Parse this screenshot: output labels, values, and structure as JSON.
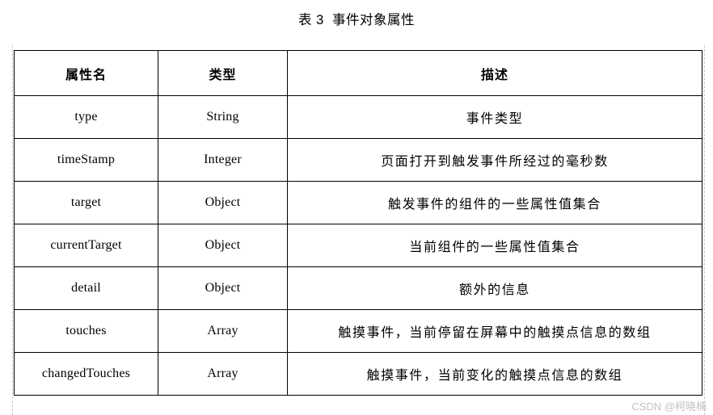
{
  "caption": "表 3  事件对象属性",
  "table": {
    "columns": [
      {
        "key": "name",
        "header": "属性名"
      },
      {
        "key": "type",
        "header": "类型"
      },
      {
        "key": "desc",
        "header": "描述"
      }
    ],
    "rows": [
      {
        "name": "type",
        "type": "String",
        "desc": "事件类型"
      },
      {
        "name": "timeStamp",
        "type": "Integer",
        "desc": "页面打开到触发事件所经过的毫秒数"
      },
      {
        "name": "target",
        "type": "Object",
        "desc": "触发事件的组件的一些属性值集合"
      },
      {
        "name": "currentTarget",
        "type": "Object",
        "desc": "当前组件的一些属性值集合"
      },
      {
        "name": "detail",
        "type": "Object",
        "desc": "额外的信息"
      },
      {
        "name": "touches",
        "type": "Array",
        "desc": "触摸事件，当前停留在屏幕中的触摸点信息的数组"
      },
      {
        "name": "changedTouches",
        "type": "Array",
        "desc": "触摸事件，当前变化的触摸点信息的数组"
      }
    ]
  },
  "watermark": "CSDN @柯晓楠",
  "colors": {
    "background": "#ffffff",
    "text": "#000000",
    "border": "#000000",
    "guide": "#c9c9c9",
    "watermark": "#c2c2c6"
  }
}
